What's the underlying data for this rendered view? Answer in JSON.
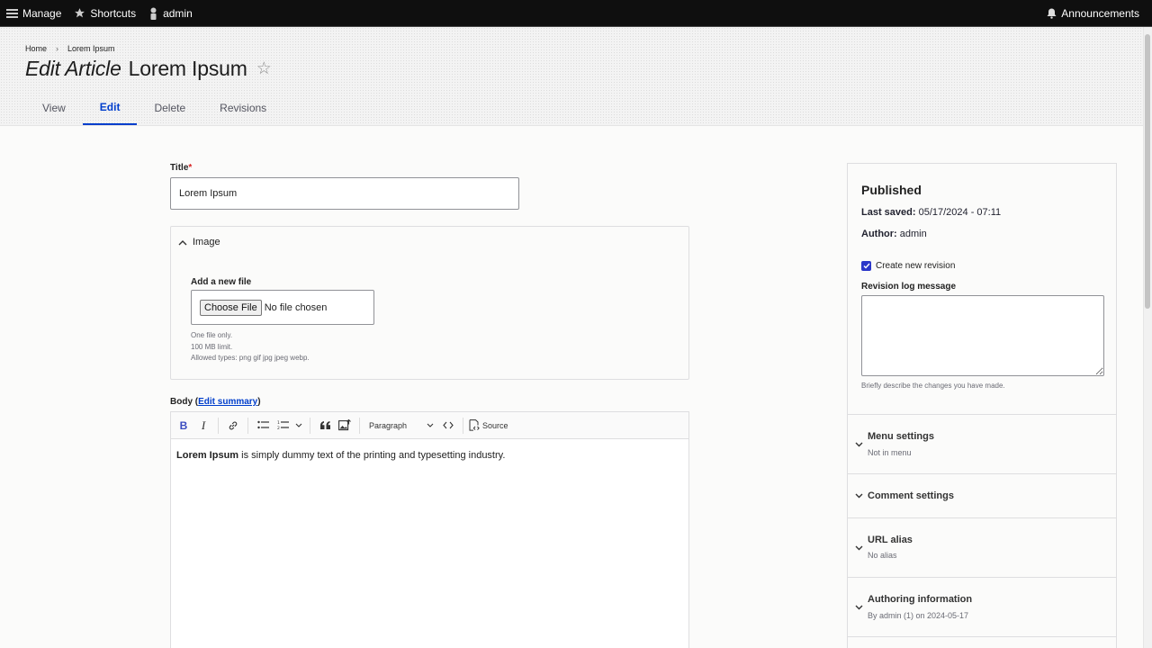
{
  "toolbar": {
    "manage": "Manage",
    "shortcuts": "Shortcuts",
    "user": "admin",
    "announcements": "Announcements"
  },
  "breadcrumb": {
    "home": "Home",
    "current": "Lorem Ipsum"
  },
  "page": {
    "title_prefix": "Edit Article",
    "title_name": "Lorem Ipsum"
  },
  "tabs": [
    {
      "label": "View"
    },
    {
      "label": "Edit"
    },
    {
      "label": "Delete"
    },
    {
      "label": "Revisions"
    }
  ],
  "form": {
    "title_label": "Title",
    "required_mark": "*",
    "title_value": "Lorem Ipsum",
    "image": {
      "summary": "Image",
      "add_label": "Add a new file",
      "choose_button": "Choose File",
      "no_file": "No file chosen",
      "desc_1": "One file only.",
      "desc_2": "100 MB limit.",
      "desc_3": "Allowed types: png gif jpg jpeg webp."
    },
    "body": {
      "label": "Body",
      "summary_link": "Edit summary",
      "format_select": "Paragraph",
      "source_button": "Source",
      "content_bold": "Lorem Ipsum",
      "content_rest": " is simply dummy text of the printing and typesetting industry."
    }
  },
  "sidebar": {
    "status": "Published",
    "last_saved_label": "Last saved:",
    "last_saved_value": "05/17/2024 - 07:11",
    "author_label": "Author:",
    "author_value": "admin",
    "create_revision": "Create new revision",
    "create_revision_checked": true,
    "revision_log_label": "Revision log message",
    "revision_log_value": "",
    "revision_log_desc": "Briefly describe the changes you have made.",
    "accordions": [
      {
        "title": "Menu settings",
        "summary": "Not in menu"
      },
      {
        "title": "Comment settings",
        "summary": ""
      },
      {
        "title": "URL alias",
        "summary": "No alias"
      },
      {
        "title": "Authoring information",
        "summary": "By admin (1) on 2024-05-17"
      }
    ]
  },
  "colors": {
    "accent": "#003ecc",
    "toolbar_bg": "#0f0f0f",
    "checkbox": "#2b37c9",
    "required": "#d72222"
  }
}
